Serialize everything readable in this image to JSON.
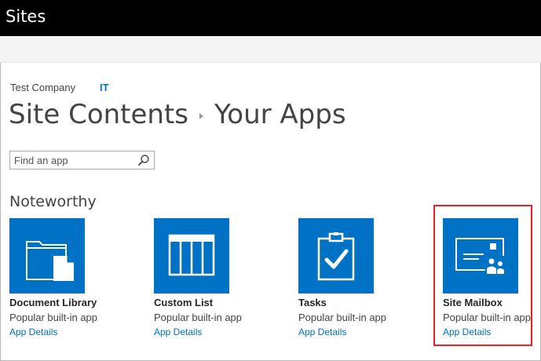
{
  "suite_bar": {
    "title": "Sites"
  },
  "breadcrumb": {
    "site": "Test Company",
    "subsite": "IT"
  },
  "title": {
    "parent": "Site Contents",
    "current": "Your Apps"
  },
  "search": {
    "placeholder": "Find an app"
  },
  "section": {
    "title": "Noteworthy"
  },
  "tiles": [
    {
      "name": "Document Library",
      "description": "Popular built-in app",
      "details": "App Details",
      "icon": "document-library-icon"
    },
    {
      "name": "Custom List",
      "description": "Popular built-in app",
      "details": "App Details",
      "icon": "custom-list-icon"
    },
    {
      "name": "Tasks",
      "description": "Popular built-in app",
      "details": "App Details",
      "icon": "tasks-icon"
    },
    {
      "name": "Site Mailbox",
      "description": "Popular built-in app",
      "details": "App Details",
      "icon": "site-mailbox-icon"
    }
  ],
  "colors": {
    "accent": "#0072c6",
    "suite_bar": "#000000",
    "highlight": "#e8202a"
  }
}
